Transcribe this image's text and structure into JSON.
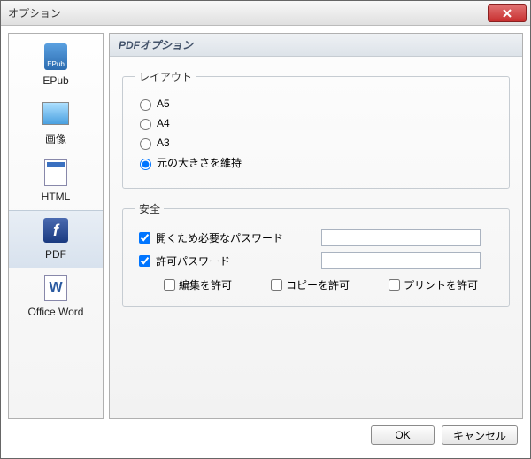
{
  "window": {
    "title": "オプション"
  },
  "sidebar": {
    "items": [
      {
        "label": "EPub"
      },
      {
        "label": "画像"
      },
      {
        "label": "HTML"
      },
      {
        "label": "PDF"
      },
      {
        "label": "Office Word"
      }
    ]
  },
  "panel": {
    "title": "PDFオプション",
    "layout": {
      "legend": "レイアウト",
      "options": {
        "a5": "A5",
        "a4": "A4",
        "a3": "A3",
        "keep": "元の大きさを維持"
      }
    },
    "security": {
      "legend": "安全",
      "open_pw_label": "開くため必要なパスワード",
      "perm_pw_label": "許可パスワード",
      "allow_edit": "編集を許可",
      "allow_copy": "コピーを許可",
      "allow_print": "プリントを許可"
    }
  },
  "buttons": {
    "ok": "OK",
    "cancel": "キャンセル"
  }
}
